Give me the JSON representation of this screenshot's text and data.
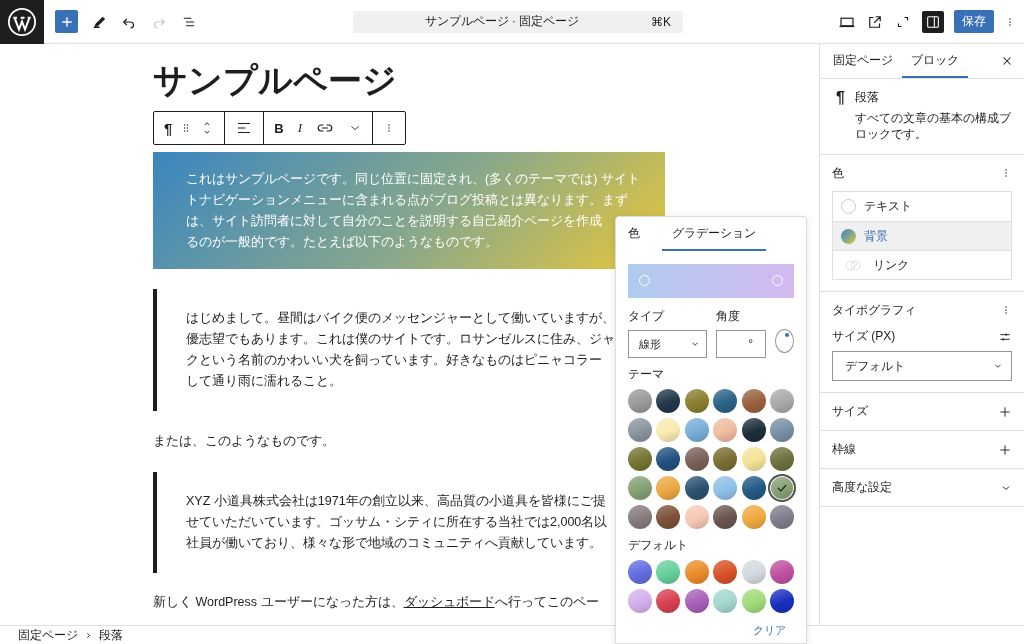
{
  "topbar": {
    "command": "サンプルページ · 固定ページ",
    "shortcut": "⌘K",
    "save": "保存",
    "redo_disabled": true,
    "sidebar_open": true
  },
  "canvas": {
    "title": "サンプルページ",
    "toolbar": {
      "pilcrow": "¶",
      "bold": "B",
      "italic": "I"
    },
    "blocks": [
      {
        "kind": "gradient",
        "lines": [
          "これはサンプルページです。同じ位置に固定され、(多くのテーマでは) サイト",
          "トナビゲーションメニューに含まれる点がブログ投稿とは異なります。まず",
          "は、サイト訪問者に対して自分のことを説明する自己紹介ページを作成",
          "るのが一般的です。たとえば以下のようなものです。"
        ]
      },
      {
        "kind": "quote",
        "lines": [
          "はじめまして。昼間はバイク便のメッセンジャーとして働いていますが、",
          "優志望でもあります。これは僕のサイトです。ロサンゼルスに住み、ジャ",
          "クという名前のかわいい犬を飼っています。好きなものはピニャコラー",
          "して通り雨に濡れること。"
        ]
      },
      {
        "kind": "paragraph",
        "lines": [
          "または、このようなものです。"
        ]
      },
      {
        "kind": "quote",
        "lines": [
          "XYZ 小道具株式会社は1971年の創立以来、高品質の小道具を皆様にご提",
          "せていただいています。ゴッサム・シティに所在する当社では2,000名以",
          "社員が働いており、様々な形で地域のコミュニティへ貢献しています。"
        ]
      },
      {
        "kind": "linked",
        "before": "新しく WordPress ユーザーになった方は、",
        "link": "ダッシュボード",
        "after": "へ行ってこのペー"
      }
    ]
  },
  "popover": {
    "tabs": [
      {
        "label": "色",
        "selected": false
      },
      {
        "label": "グラデーション",
        "selected": true
      }
    ],
    "type_label": "タイプ",
    "type_value": "線形",
    "angle_label": "角度",
    "angle_unit": "°",
    "theme_label": "テーマ",
    "theme": [
      {
        "color": "#9a9a9a",
        "selected": false
      },
      {
        "color": "#22384a",
        "selected": false
      },
      {
        "color": "#8a7f2e",
        "selected": false
      },
      {
        "color": "#2a6288",
        "selected": false
      },
      {
        "color": "#9a6240",
        "selected": false
      },
      {
        "color": "#aaaaaa",
        "selected": false
      },
      {
        "color": "#8a95a0",
        "selected": false
      },
      {
        "color": "#f8eab0",
        "selected": false
      },
      {
        "color": "#78aed8",
        "selected": false
      },
      {
        "color": "#f0bca0",
        "selected": false
      },
      {
        "color": "#1f2f3a",
        "selected": false
      },
      {
        "color": "#7a90a6",
        "selected": false
      },
      {
        "color": "#757532",
        "selected": false
      },
      {
        "color": "#225280",
        "selected": false
      },
      {
        "color": "#7a6258",
        "selected": false
      },
      {
        "color": "#7a6e32",
        "selected": false
      },
      {
        "color": "#f4e498",
        "selected": false
      },
      {
        "color": "#6e7040",
        "selected": false
      },
      {
        "color": "#86a074",
        "selected": false
      },
      {
        "color": "#eca840",
        "selected": false
      },
      {
        "color": "#2c5272",
        "selected": false
      },
      {
        "color": "#90c0e8",
        "selected": false
      },
      {
        "color": "#225a84",
        "selected": false
      },
      {
        "color": "#86a074",
        "selected": true
      },
      {
        "color": "#867c7c",
        "selected": false
      },
      {
        "color": "#7a5238",
        "selected": false
      },
      {
        "color": "#f6c8b4",
        "selected": false
      },
      {
        "color": "#6a5650",
        "selected": false
      },
      {
        "color": "#f0aa40",
        "selected": false
      },
      {
        "color": "#7e7e8e",
        "selected": false
      }
    ],
    "default_label": "デフォルト",
    "defaults": [
      {
        "color": "#626de0",
        "selected": false
      },
      {
        "color": "#66d09a",
        "selected": false
      },
      {
        "color": "#ec8c2a",
        "selected": false
      },
      {
        "color": "#d85228",
        "selected": false
      },
      {
        "color": "#d4dae0",
        "selected": false
      },
      {
        "color": "#c050a0",
        "selected": false
      },
      {
        "color": "#d4b0ec",
        "selected": false
      },
      {
        "color": "#d84050",
        "selected": false
      },
      {
        "color": "#a860b8",
        "selected": false
      },
      {
        "color": "#a4d8d0",
        "selected": false
      },
      {
        "color": "#a0dc78",
        "selected": false
      },
      {
        "color": "#1830c0",
        "selected": false
      }
    ],
    "clear": "クリア"
  },
  "sidebar": {
    "tabs": [
      {
        "label": "固定ページ",
        "selected": false
      },
      {
        "label": "ブロック",
        "selected": true
      }
    ],
    "block": {
      "icon": "¶",
      "name": "段落",
      "description": "すべての文章の基本の構成ブロックです。"
    },
    "color_panel": {
      "title": "色",
      "items": [
        {
          "label": "テキスト",
          "kind": "empty",
          "selected": false
        },
        {
          "label": "背景",
          "kind": "gradient",
          "selected": true
        },
        {
          "label": "リンク",
          "kind": "split",
          "selected": false
        }
      ]
    },
    "typography": {
      "title": "タイポグラフィ",
      "size_label": "サイズ (PX)",
      "size_value": "デフォルト"
    },
    "panels": [
      {
        "title": "サイズ",
        "kind": "plus"
      },
      {
        "title": "枠線",
        "kind": "plus"
      },
      {
        "title": "高度な設定",
        "kind": "chevron"
      }
    ]
  },
  "statusbar": {
    "breadcrumbs": [
      "固定ページ",
      "段落"
    ]
  }
}
